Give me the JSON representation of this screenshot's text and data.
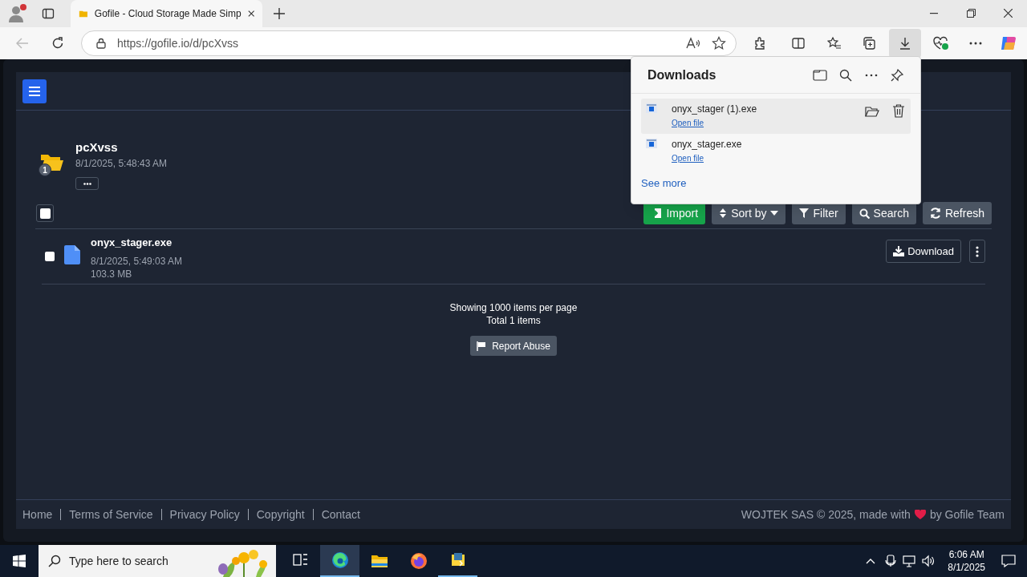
{
  "browser": {
    "tab_title": "Gofile - Cloud Storage Made Simp",
    "url": "https://gofile.io/d/pcXvss",
    "downloads_active": true
  },
  "downloads_panel": {
    "title": "Downloads",
    "items": [
      {
        "name": "onyx_stager (1).exe",
        "link": "Open file",
        "selected": true
      },
      {
        "name": "onyx_stager.exe",
        "link": "Open file",
        "selected": false
      }
    ],
    "see_more": "See more"
  },
  "folder": {
    "name": "pcXvss",
    "created": "8/1/2025, 5:48:43 AM",
    "count": "1"
  },
  "select_all": {
    "checked": false
  },
  "toolbar": [
    {
      "kind": "import",
      "label": "Import"
    },
    {
      "kind": "sort",
      "label": "Sort by"
    },
    {
      "kind": "filter",
      "label": "Filter"
    },
    {
      "kind": "search",
      "label": "Search"
    },
    {
      "kind": "refresh",
      "label": "Refresh"
    }
  ],
  "files": [
    {
      "name": "onyx_stager.exe",
      "date": "8/1/2025, 5:49:03 AM",
      "size": "103.3 MB",
      "checked": false,
      "download": "Download"
    }
  ],
  "pagination": {
    "per_page": "Showing 1000 items per page",
    "total": "Total 1 items"
  },
  "report": "Report Abuse",
  "footer": {
    "links": [
      "Home",
      "Terms of Service",
      "Privacy Policy",
      "Copyright",
      "Contact"
    ],
    "credit_before": "WOJTEK SAS © 2025, made with",
    "credit_after": "by Gofile Team"
  },
  "taskbar": {
    "search_placeholder": "Type here to search",
    "time": "6:06 AM",
    "date": "8/1/2025",
    "apps": [
      {
        "kind": "taskview",
        "selected": false,
        "running": false
      },
      {
        "kind": "edge",
        "selected": true,
        "running": true
      },
      {
        "kind": "files",
        "selected": false,
        "running": false
      },
      {
        "kind": "firefox",
        "selected": false,
        "running": false
      },
      {
        "kind": "python",
        "selected": false,
        "running": true
      }
    ]
  }
}
